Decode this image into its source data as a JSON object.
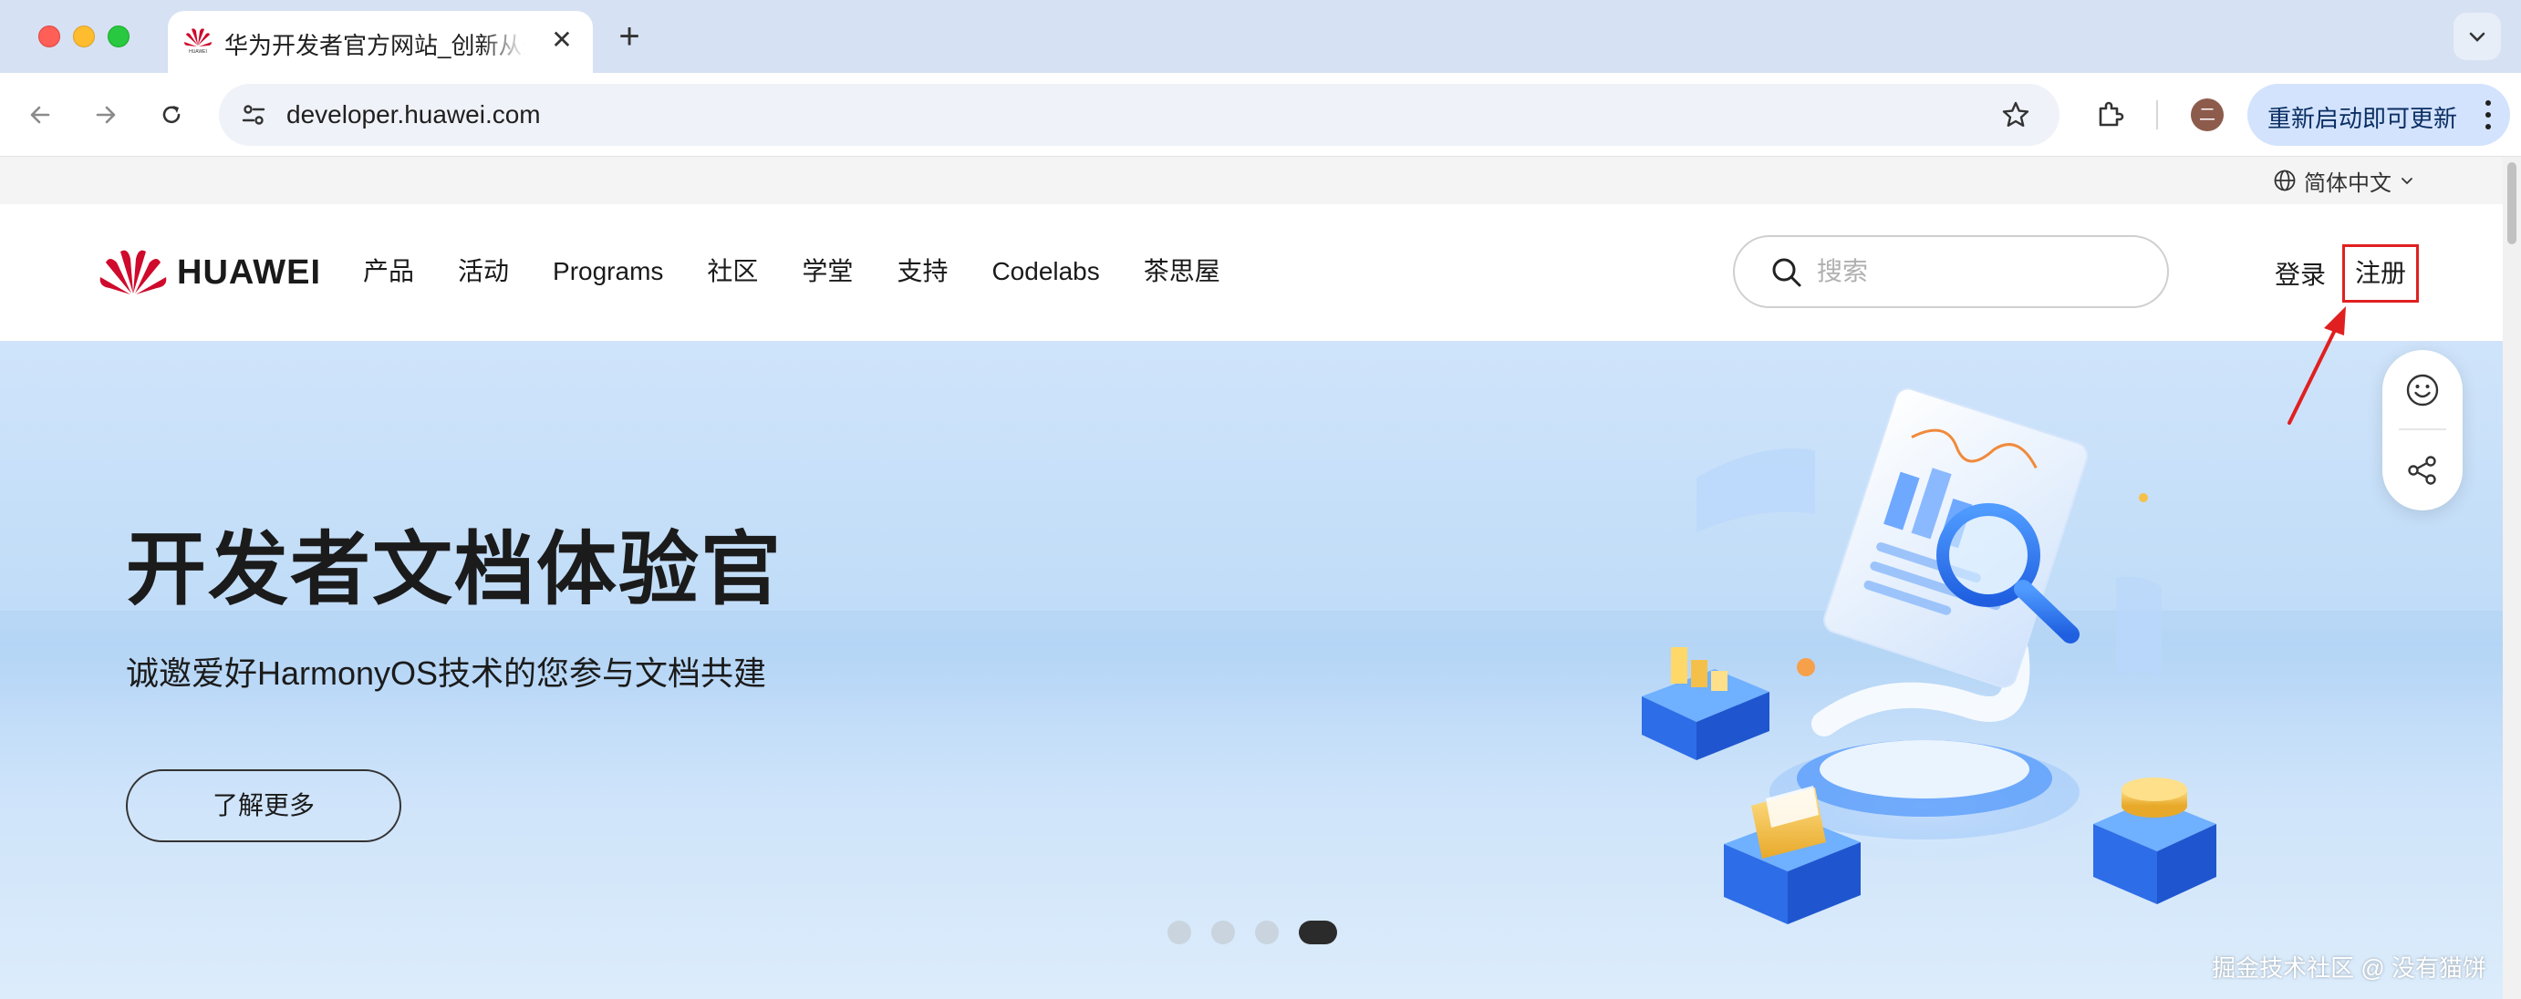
{
  "browser": {
    "tab_title": "华为开发者官方网站_创新从这里开始",
    "new_tab": "+",
    "tab_close": "✕",
    "url": "developer.huawei.com",
    "profile_initial": "二",
    "update_label": "重新启动即可更新"
  },
  "page": {
    "language": "简体中文",
    "logo_text": "HUAWEI",
    "nav": [
      "产品",
      "活动",
      "Programs",
      "社区",
      "学堂",
      "支持",
      "Codelabs",
      "茶思屋"
    ],
    "search_placeholder": "搜索",
    "login": "登录",
    "register": "注册"
  },
  "hero": {
    "title": "开发者文档体验官",
    "subtitle": "诚邀爱好HarmonyOS技术的您参与文档共建",
    "button": "了解更多",
    "carousel_count": 4,
    "carousel_active": 4
  },
  "watermark": "掘金技术社区 @ 没有猫饼",
  "colors": {
    "accent_red": "#e02020",
    "hero_bg": "#c6def8",
    "update_btn": "#d3e3fd"
  },
  "icons": [
    "back-arrow-icon",
    "forward-arrow-icon",
    "reload-icon",
    "site-info-icon",
    "bookmark-star-icon",
    "extensions-icon",
    "globe-icon",
    "chevron-down-icon",
    "search-icon",
    "smile-icon",
    "share-icon",
    "huawei-flower-icon"
  ]
}
